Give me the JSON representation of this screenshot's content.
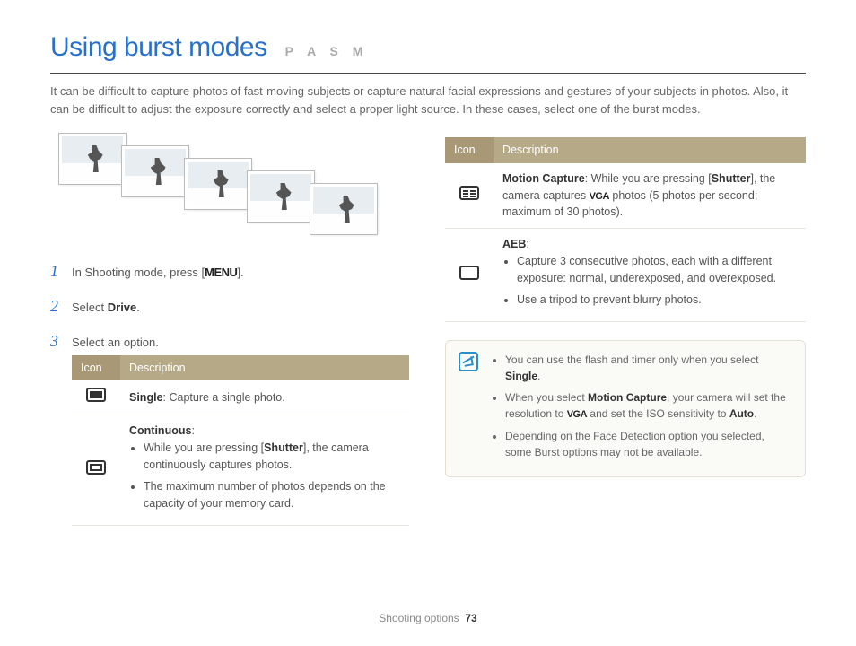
{
  "header": {
    "title": "Using burst modes",
    "modes": "P A S M"
  },
  "intro": "It can be difficult to capture photos of fast-moving subjects or capture natural facial expressions and gestures of your subjects in photos. Also, it can be difficult to adjust the exposure correctly and select a proper light source. In these cases, select one of the burst modes.",
  "steps": {
    "s1_pre": "In Shooting mode, press [",
    "s1_menu": "MENU",
    "s1_post": "].",
    "s2_pre": "Select ",
    "s2_bold": "Drive",
    "s2_post": ".",
    "s3": "Select an option."
  },
  "table": {
    "h_icon": "Icon",
    "h_desc": "Description",
    "single_bold": "Single",
    "single_text": ": Capture a single photo.",
    "cont_title": "Continuous",
    "cont_colon": ":",
    "cont_b1_pre": "While you are pressing [",
    "cont_b1_bold": "Shutter",
    "cont_b1_post": "], the camera continuously captures photos.",
    "cont_b2": "The maximum number of photos depends on the capacity of your memory card.",
    "motion_bold": "Motion Capture",
    "motion_pre": ": While you are pressing [",
    "motion_shutter": "Shutter",
    "motion_mid": "], the camera captures ",
    "motion_vga": "VGA",
    "motion_post": " photos (5 photos per second; maximum of 30 photos).",
    "aeb_title": "AEB",
    "aeb_colon": ":",
    "aeb_b1": "Capture 3 consecutive photos, each with a different exposure: normal, underexposed, and overexposed.",
    "aeb_b2": "Use a tripod to prevent blurry photos."
  },
  "notes": {
    "n1_pre": "You can use the flash and timer only when you select ",
    "n1_bold": "Single",
    "n1_post": ".",
    "n2_pre": "When you select ",
    "n2_bold": "Motion Capture",
    "n2_mid": ", your camera will set the resolution to ",
    "n2_vga": "VGA",
    "n2_mid2": " and set the ISO sensitivity to ",
    "n2_bold2": "Auto",
    "n2_post": ".",
    "n3": "Depending on the Face Detection option you selected, some Burst options may not be available."
  },
  "footer": {
    "section": "Shooting options",
    "page": "73"
  }
}
